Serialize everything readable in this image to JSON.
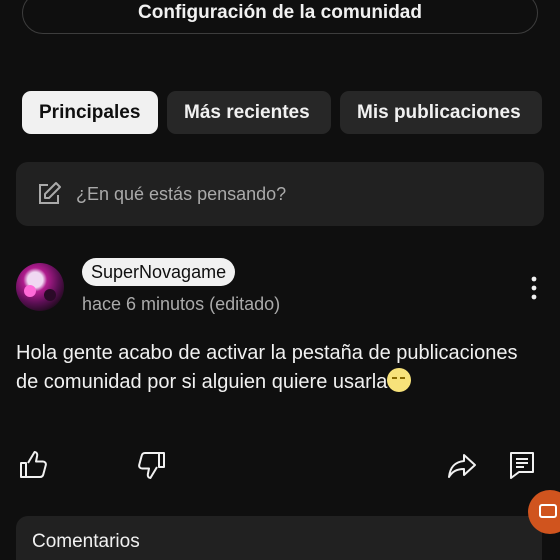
{
  "header": {
    "config_button_label": "Configuración de la comunidad"
  },
  "tabs": [
    {
      "label": "Principales",
      "active": true
    },
    {
      "label": "Más recientes",
      "active": false
    },
    {
      "label": "Mis publicaciones",
      "active": false
    }
  ],
  "composer": {
    "placeholder": "¿En qué estás pensando?",
    "icon": "edit-icon"
  },
  "post": {
    "author": "SuperNovagame",
    "time": "hace 6 minutos (editado)",
    "text": "Hola gente acabo de activar la pestaña de publicaciones de comunidad por si alguien quiere usarla",
    "emoji": "moon-face",
    "actions": [
      "like-icon",
      "dislike-icon",
      "share-icon",
      "comment-icon"
    ]
  },
  "comments": {
    "label": "Comentarios"
  },
  "colors": {
    "background": "#0f0f0f",
    "card": "#212121",
    "chip": "#272727",
    "accent": "#d0541e"
  }
}
